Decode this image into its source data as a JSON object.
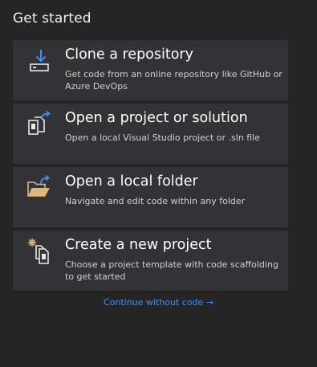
{
  "page": {
    "title": "Get started"
  },
  "options": [
    {
      "icon": "download-icon",
      "title": "Clone a repository",
      "description": "Get code from an online repository like GitHub or Azure DevOps"
    },
    {
      "icon": "open-project-icon",
      "title": "Open a project or solution",
      "description": "Open a local Visual Studio project or .sln file"
    },
    {
      "icon": "open-folder-icon",
      "title": "Open a local folder",
      "description": "Navigate and edit code within any folder"
    },
    {
      "icon": "new-project-icon",
      "title": "Create a new project",
      "description": "Choose a project template with code scaffolding to get started"
    }
  ],
  "footer": {
    "continue_label": "Continue without code →"
  },
  "colors": {
    "accent": "#3794ff",
    "folder": "#dcb67a",
    "card": "#333337",
    "background": "#252526"
  }
}
